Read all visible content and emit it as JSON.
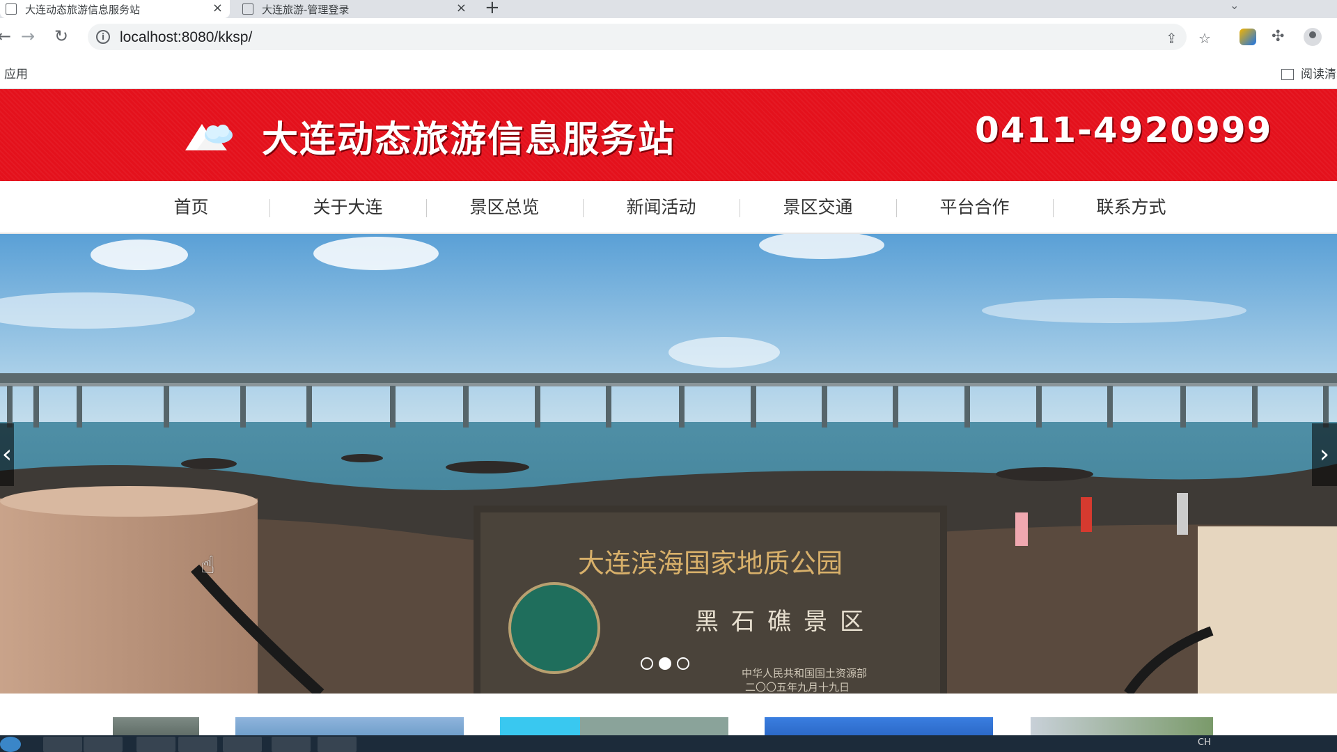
{
  "browser": {
    "tabs": [
      {
        "title": "大连动态旅游信息服务站",
        "active": true
      },
      {
        "title": "大连旅游-管理登录",
        "active": false
      }
    ],
    "new_tab_label": "+",
    "url": "localhost:8080/kksp/",
    "bookmarks": {
      "apps": "应用",
      "reading_list": "阅读清单"
    }
  },
  "site": {
    "title": "大连动态旅游信息服务站",
    "hotline": "0411-4920999",
    "brand_color": "#e4111c",
    "nav": [
      "首页",
      "关于大连",
      "景区总览",
      "新闻活动",
      "景区交通",
      "平台合作",
      "联系方式"
    ]
  },
  "banner": {
    "monument_line1": "大连滨海国家地质公园",
    "monument_line2": "黑石礁景区",
    "monument_line3": "中华人民共和国国土资源部",
    "monument_line4": "二〇〇五年九月十九日",
    "slides": 3,
    "active_slide": 2,
    "next_label": "›",
    "prev_label": "‹"
  },
  "taskbar": {
    "input_indicator": "CH"
  }
}
